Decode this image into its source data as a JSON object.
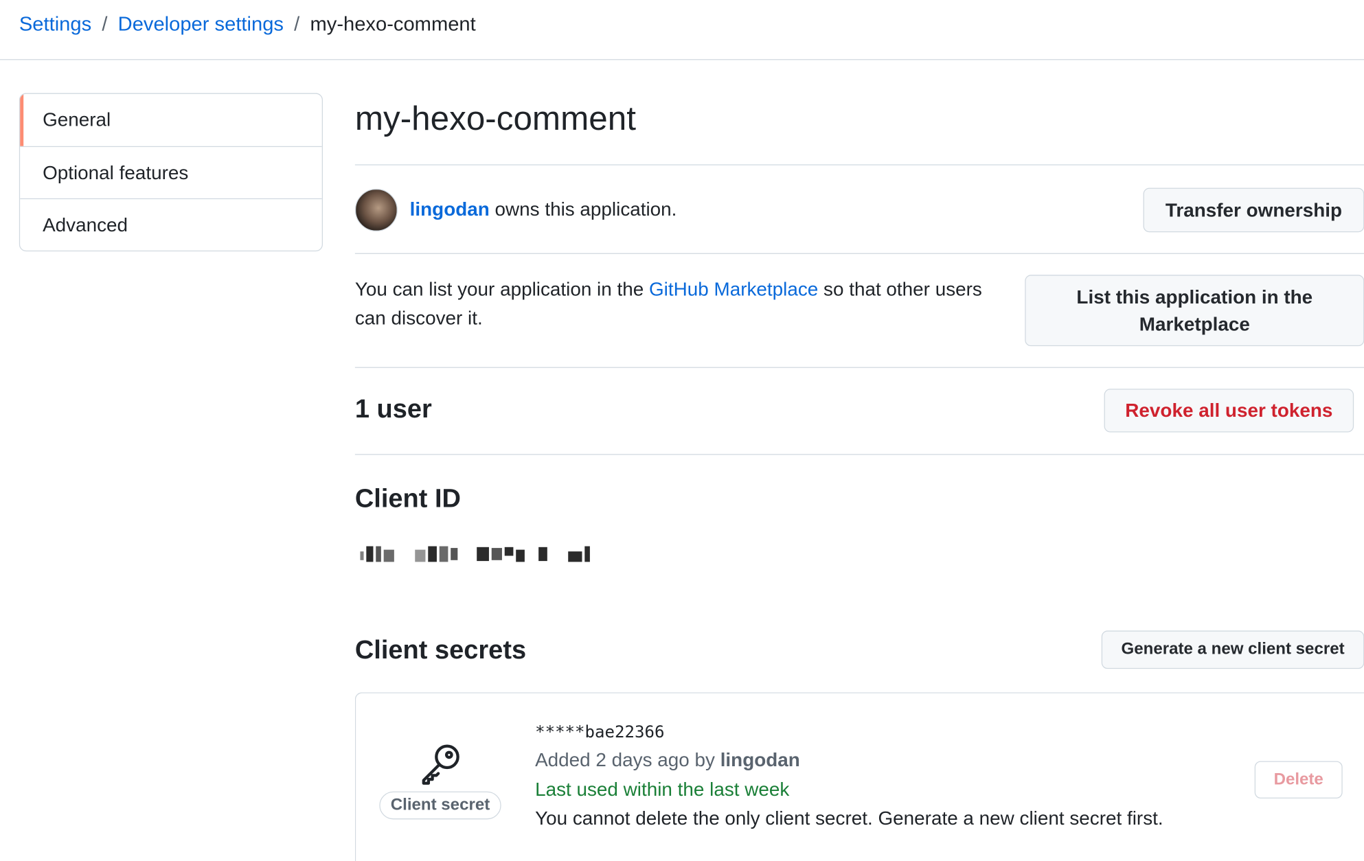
{
  "breadcrumb": {
    "items": [
      "Settings",
      "Developer settings"
    ],
    "separator": "/",
    "current": "my-hexo-comment"
  },
  "sidebar": {
    "items": [
      {
        "label": "General",
        "active": true
      },
      {
        "label": "Optional features",
        "active": false
      },
      {
        "label": "Advanced",
        "active": false
      }
    ]
  },
  "main": {
    "title": "my-hexo-comment",
    "owner": {
      "name": "lingodan",
      "suffix": " owns this application.",
      "transfer_button": "Transfer ownership"
    },
    "marketplace": {
      "text_before": "You can list your application in the ",
      "link": "GitHub Marketplace",
      "text_after": " so that other users can discover it.",
      "button": "List this application in the Marketplace"
    },
    "users": {
      "count": "1",
      "label": " user",
      "revoke_button": "Revoke all user tokens"
    },
    "client_id": {
      "heading": "Client ID"
    },
    "client_secrets": {
      "heading": "Client secrets",
      "generate_button": "Generate a new client secret",
      "secret": {
        "badge": "Client secret",
        "value": "*****bae22366",
        "added_prefix": "Added 2 days ago by ",
        "added_by": "lingodan",
        "last_used": "Last used within the last week",
        "note": "You cannot delete the only client secret. Generate a new client secret first.",
        "delete_button": "Delete"
      }
    }
  },
  "colors": {
    "link": "#0969da",
    "danger": "#cf222e",
    "success": "#1a7f37",
    "active_indicator": "#fd8c73",
    "border": "#d1d9e0"
  }
}
